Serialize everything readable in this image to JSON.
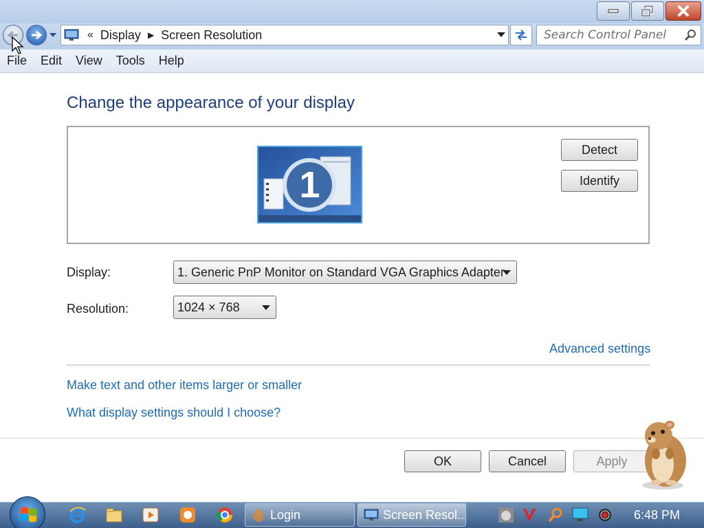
{
  "window": {
    "controls": [
      "minimize",
      "restore",
      "close"
    ]
  },
  "address_bar": {
    "overflow": "«",
    "crumbs": [
      "Display",
      "Screen Resolution"
    ]
  },
  "search": {
    "placeholder": "Search Control Panel"
  },
  "menu": [
    "File",
    "Edit",
    "View",
    "Tools",
    "Help"
  ],
  "main": {
    "heading": "Change the appearance of your display",
    "monitor_number": "1",
    "detect_label": "Detect",
    "identify_label": "Identify",
    "display_label": "Display:",
    "display_value": "1. Generic PnP Monitor on Standard VGA Graphics Adapter",
    "resolution_label": "Resolution:",
    "resolution_value": "1024 × 768",
    "advanced_link": "Advanced settings",
    "link_text_size": "Make text and other items larger or smaller",
    "link_display_help": "What display settings should I choose?"
  },
  "buttons": {
    "ok": "OK",
    "cancel": "Cancel",
    "apply": "Apply"
  },
  "taskbar": {
    "tasks": [
      {
        "label": "Login"
      },
      {
        "label": "Screen Resol..."
      }
    ],
    "clock": "6:48 PM"
  },
  "colors": {
    "heading": "#1e3f77",
    "link": "#1f6cb0",
    "taskbar": "#4d6f99"
  }
}
